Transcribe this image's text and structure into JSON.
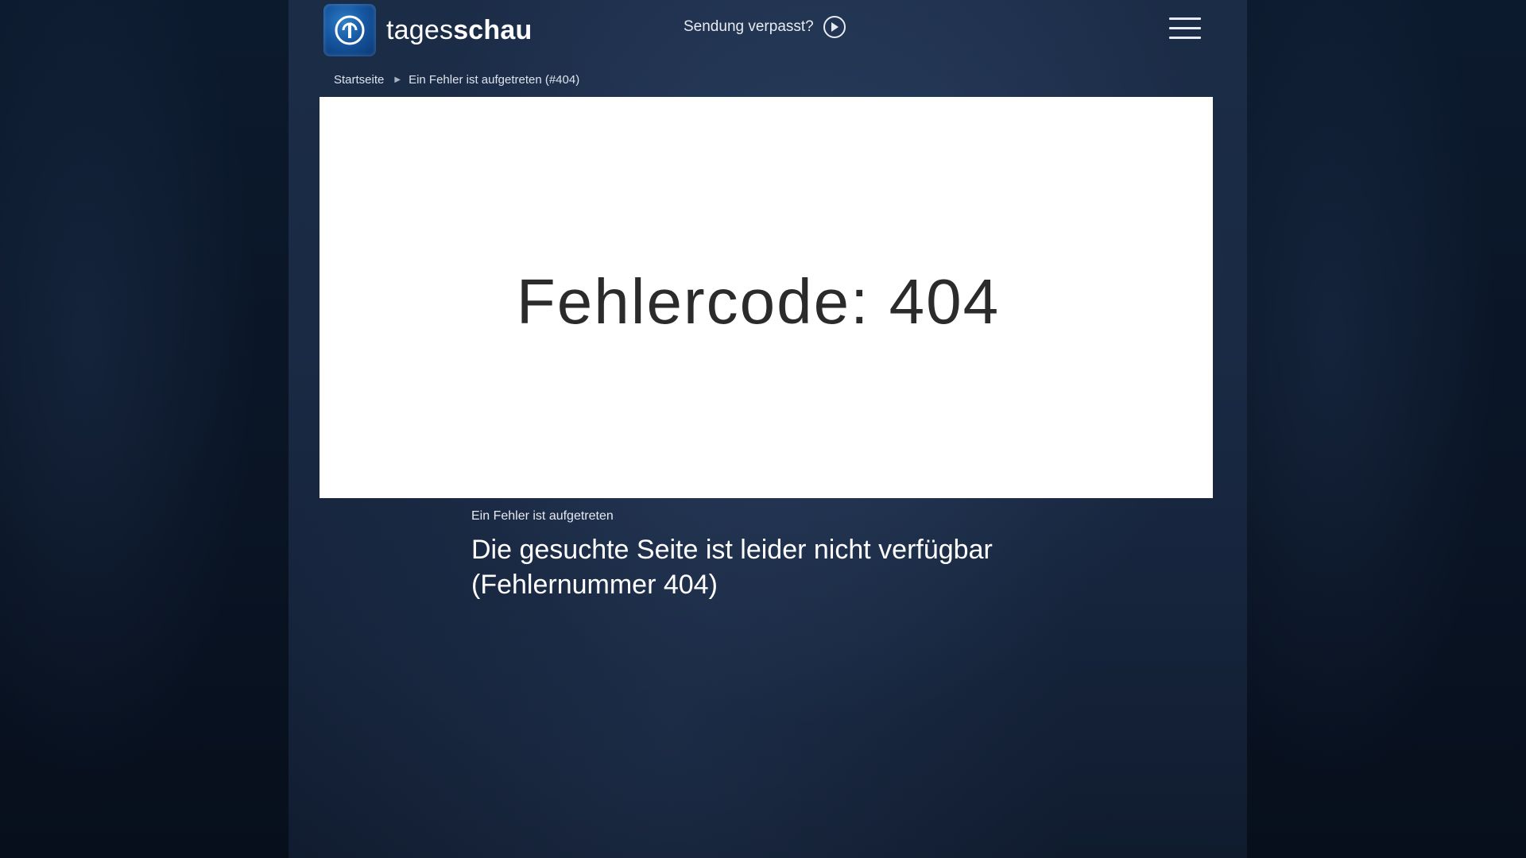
{
  "header": {
    "logo_text_light": "tages",
    "logo_text_bold": "schau",
    "missed_show_label": "Sendung verpasst?"
  },
  "breadcrumb": {
    "home": "Startseite",
    "current": "Ein Fehler ist aufgetreten (#404)"
  },
  "hero": {
    "title": "Fehlercode: 404"
  },
  "article": {
    "topline": "Ein Fehler ist aufgetreten",
    "headline": "Die gesuchte Seite ist leider nicht verfügbar (Fehlernummer 404)"
  },
  "colors": {
    "background": "#1a2a44",
    "hero_background": "#ffffff",
    "hero_text": "#2b2b2b",
    "logo_blue": "#1556a0"
  },
  "icons": {
    "logo": "ard-one-logo-icon",
    "play": "play-circle-icon",
    "menu": "hamburger-menu-icon",
    "breadcrumb_separator": "triangle-right-icon"
  }
}
